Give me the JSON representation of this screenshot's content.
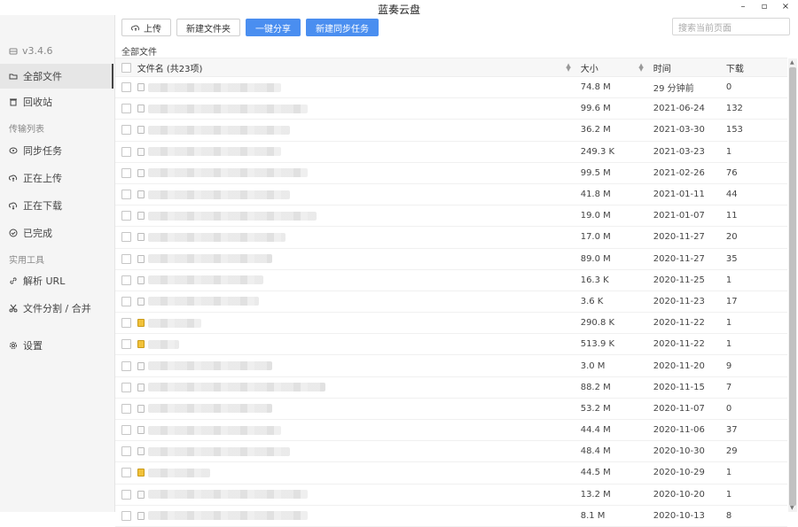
{
  "window": {
    "title": "蓝奏云盘",
    "min": "–",
    "max": "▫",
    "close": "×"
  },
  "sidebar": {
    "version": "v3.4.6",
    "items": [
      {
        "label": "全部文件",
        "icon": "folder-open-icon"
      },
      {
        "label": "回收站",
        "icon": "trash-icon"
      },
      {
        "label": "同步任务",
        "icon": "sync-icon"
      },
      {
        "label": "正在上传",
        "icon": "upload-cloud-icon"
      },
      {
        "label": "正在下载",
        "icon": "download-cloud-icon"
      },
      {
        "label": "已完成",
        "icon": "check-circle-icon"
      },
      {
        "label": "解析 URL",
        "icon": "link-icon"
      },
      {
        "label": "文件分割 / 合并",
        "icon": "scissors-icon"
      },
      {
        "label": "设置",
        "icon": "gear-icon"
      }
    ],
    "sections": [
      "传输列表",
      "实用工具"
    ]
  },
  "toolbar": {
    "upload": "上传",
    "new_folder": "新建文件夹",
    "share": "一键分享",
    "new_sync": "新建同步任务"
  },
  "search": {
    "placeholder": "搜索当前页面"
  },
  "breadcrumb": "全部文件",
  "table": {
    "headers": {
      "name": "文件名 (共23项)",
      "size": "大小",
      "time": "时间",
      "downloads": "下载"
    },
    "rows": [
      {
        "size": "74.8 M",
        "time": "29 分钟前",
        "dl": "0"
      },
      {
        "size": "99.6 M",
        "time": "2021-06-24",
        "dl": "132"
      },
      {
        "size": "36.2 M",
        "time": "2021-03-30",
        "dl": "153"
      },
      {
        "size": "249.3 K",
        "time": "2021-03-23",
        "dl": "1"
      },
      {
        "size": "99.5 M",
        "time": "2021-02-26",
        "dl": "76"
      },
      {
        "size": "41.8 M",
        "time": "2021-01-11",
        "dl": "44"
      },
      {
        "size": "19.0 M",
        "time": "2021-01-07",
        "dl": "11"
      },
      {
        "size": "17.0 M",
        "time": "2020-11-27",
        "dl": "20"
      },
      {
        "size": "89.0 M",
        "time": "2020-11-27",
        "dl": "35"
      },
      {
        "size": "16.3 K",
        "time": "2020-11-25",
        "dl": "1"
      },
      {
        "size": "3.6 K",
        "time": "2020-11-23",
        "dl": "17"
      },
      {
        "size": "290.8 K",
        "time": "2020-11-22",
        "dl": "1"
      },
      {
        "size": "513.9 K",
        "time": "2020-11-22",
        "dl": "1"
      },
      {
        "size": "3.0 M",
        "time": "2020-11-20",
        "dl": "9"
      },
      {
        "size": "88.2 M",
        "time": "2020-11-15",
        "dl": "7"
      },
      {
        "size": "53.2 M",
        "time": "2020-11-07",
        "dl": "0"
      },
      {
        "size": "44.4 M",
        "time": "2020-11-06",
        "dl": "37"
      },
      {
        "size": "48.4 M",
        "time": "2020-10-30",
        "dl": "29"
      },
      {
        "size": "44.5 M",
        "time": "2020-10-29",
        "dl": "1"
      },
      {
        "size": "13.2 M",
        "time": "2020-10-20",
        "dl": "1"
      },
      {
        "size": "8.1 M",
        "time": "2020-10-13",
        "dl": "8"
      }
    ]
  }
}
